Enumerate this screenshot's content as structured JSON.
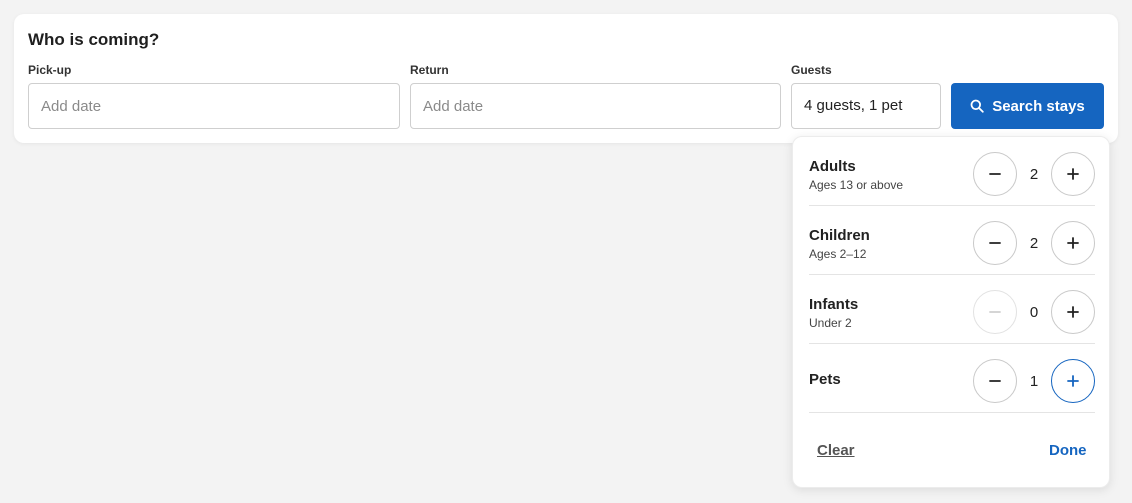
{
  "form": {
    "title": "Who is coming?",
    "pickup": {
      "label": "Pick-up",
      "placeholder": "Add date",
      "value": ""
    },
    "return": {
      "label": "Return",
      "placeholder": "Add date",
      "value": ""
    },
    "guests": {
      "label": "Guests",
      "value": "4 guests, 1 pet"
    },
    "search_label": "Search stays"
  },
  "guests_popover": {
    "rows": [
      {
        "title": "Adults",
        "subtitle": "Ages 13 or above",
        "count": "2",
        "decrement_disabled": false
      },
      {
        "title": "Children",
        "subtitle": "Ages 2–12",
        "count": "2",
        "decrement_disabled": false
      },
      {
        "title": "Infants",
        "subtitle": "Under 2",
        "count": "0",
        "decrement_disabled": true
      },
      {
        "title": "Pets",
        "subtitle": "",
        "count": "1",
        "decrement_disabled": false
      }
    ],
    "clear_label": "Clear",
    "done_label": "Done"
  },
  "colors": {
    "accent": "#1565c0",
    "background": "#f3f3f3",
    "card": "#ffffff"
  },
  "icons": {
    "search": "search-icon",
    "minus": "minus-icon",
    "plus": "plus-icon"
  }
}
